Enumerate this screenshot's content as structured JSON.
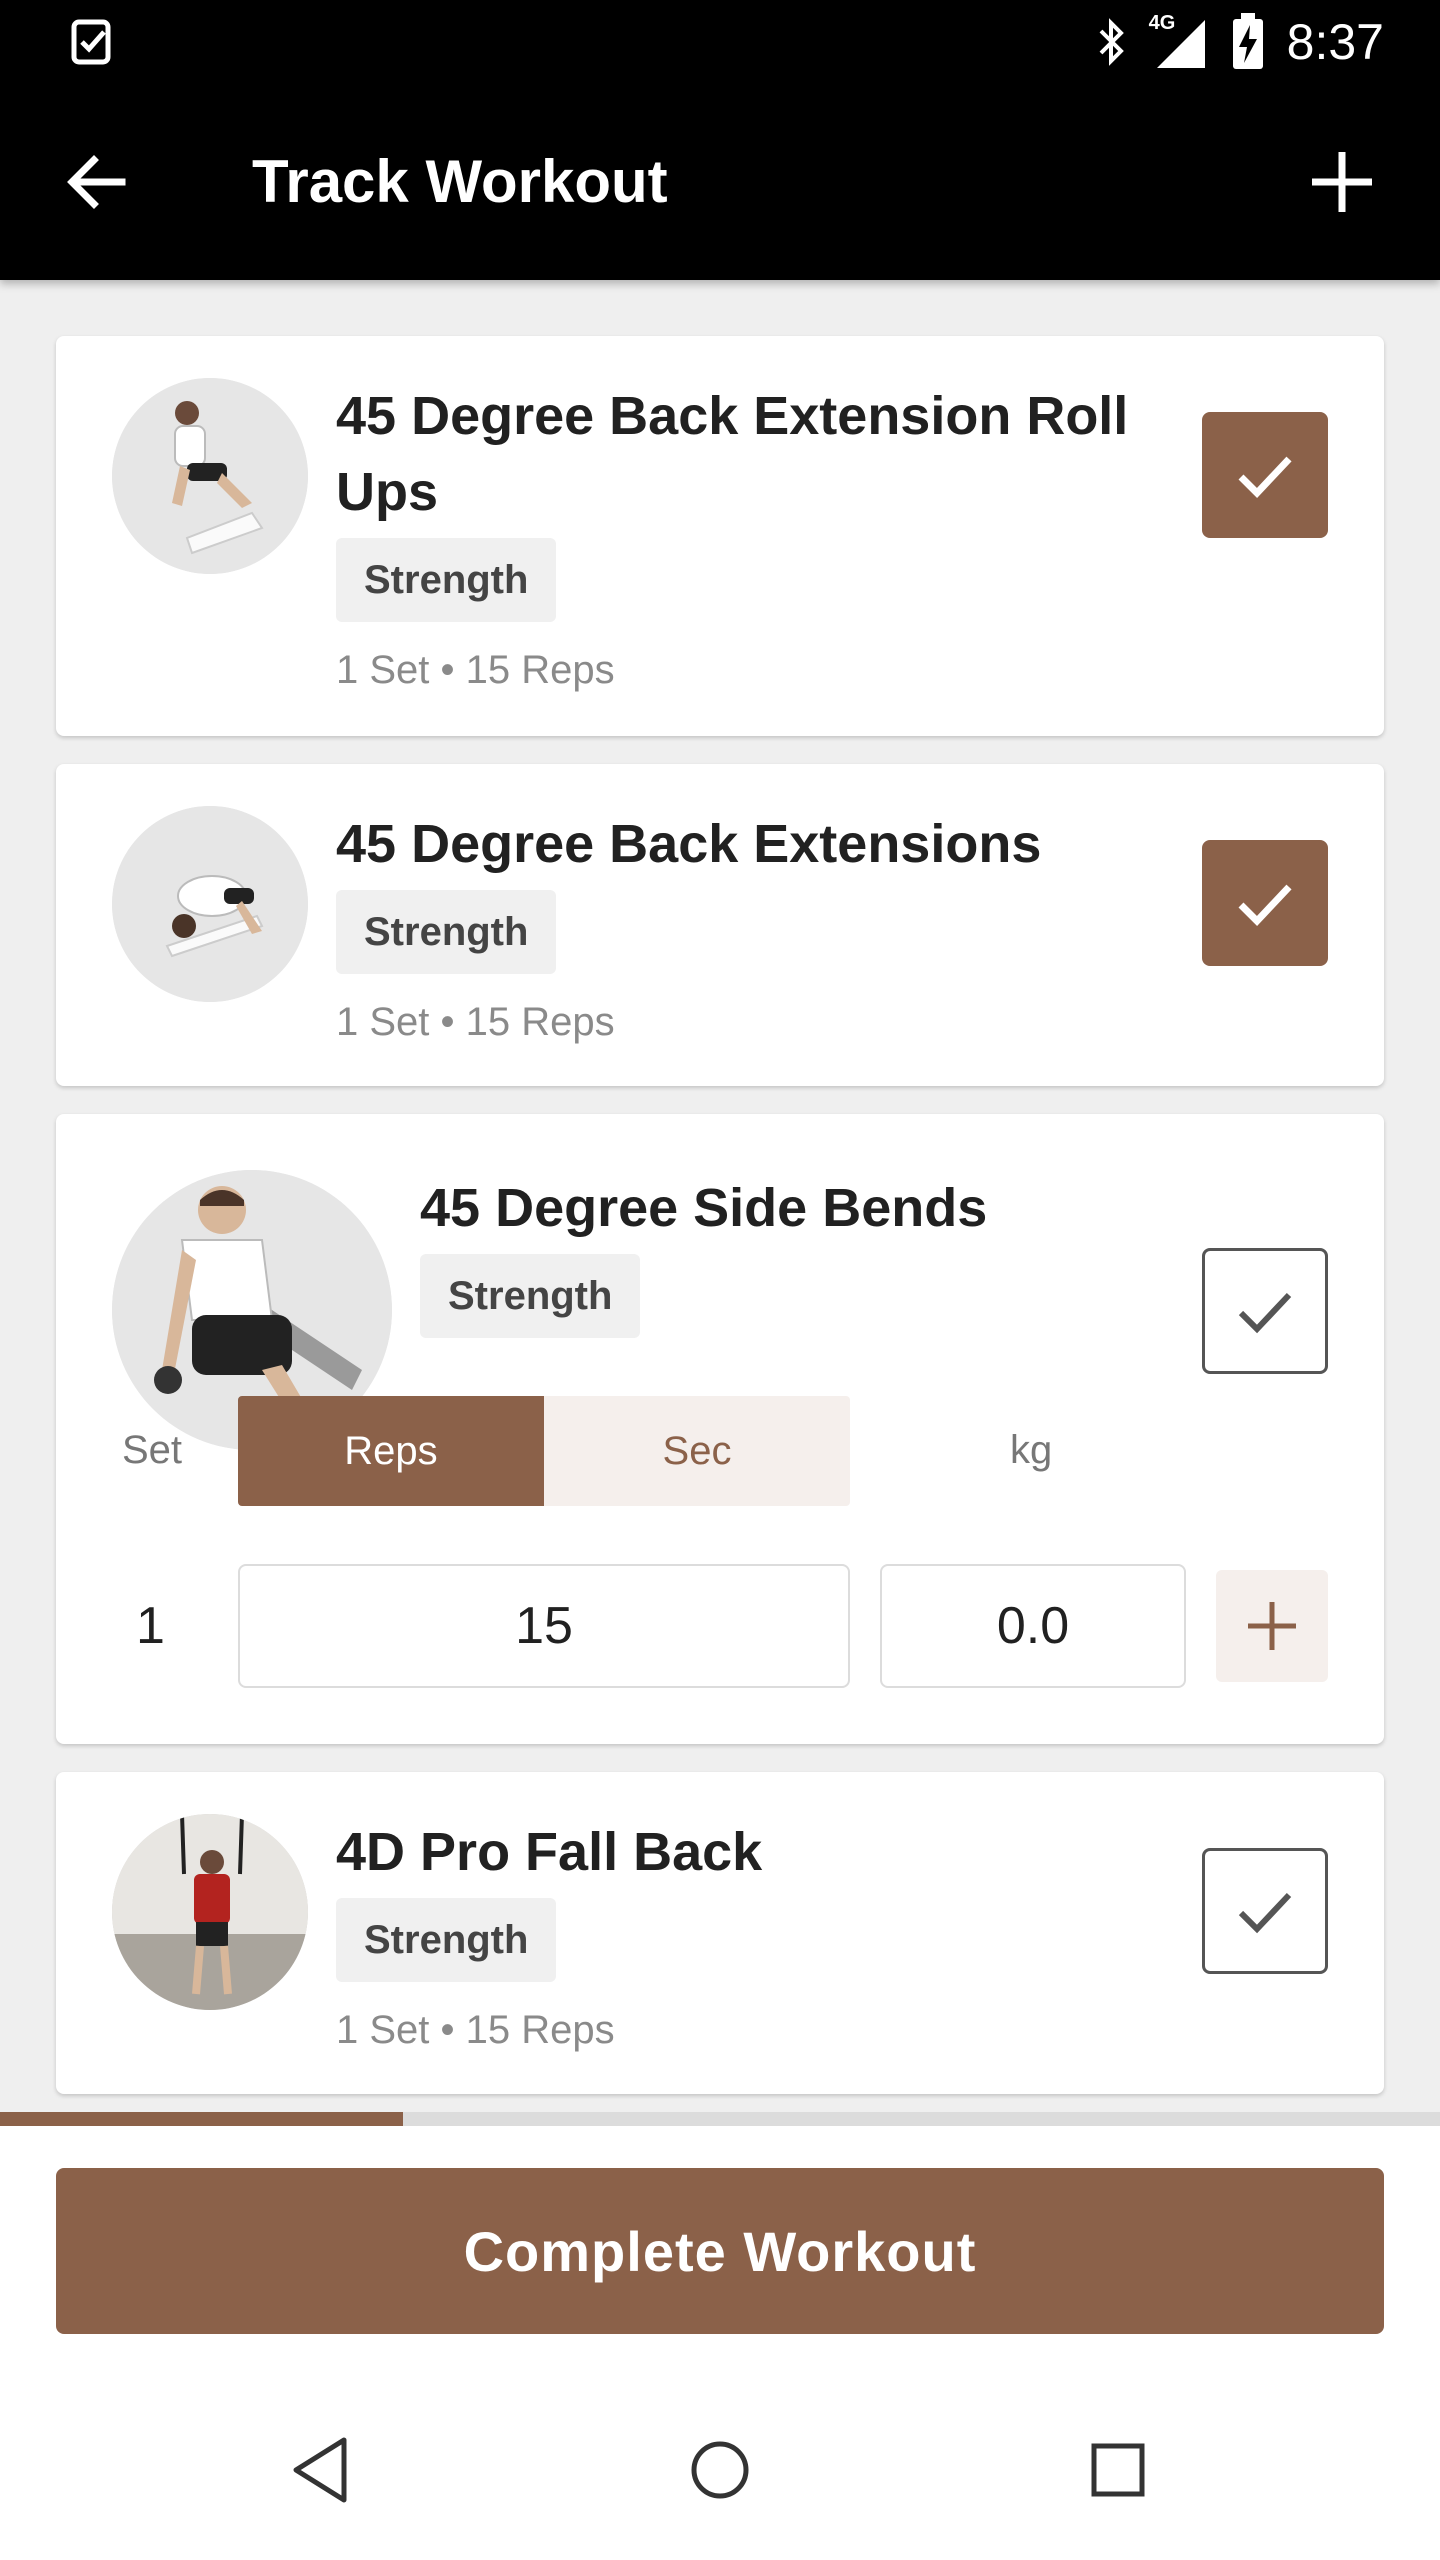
{
  "status_bar": {
    "time": "8:37",
    "network": "4G",
    "icons": [
      "task-check-icon",
      "bluetooth-icon",
      "signal-icon",
      "battery-charging-icon"
    ]
  },
  "app_bar": {
    "title": "Track Workout",
    "icons": [
      "back-arrow-icon",
      "plus-icon"
    ]
  },
  "exercises": [
    {
      "name": "45 Degree Back Extension Roll Ups",
      "category": "Strength",
      "summary": "1 Set • 15 Reps",
      "completed": true
    },
    {
      "name": "45 Degree Back Extensions",
      "category": "Strength",
      "summary": "1 Set • 15 Reps",
      "completed": true
    },
    {
      "name": "45 Degree Side Bends",
      "category": "Strength",
      "completed": false,
      "expanded": true,
      "columns": {
        "set": "Set",
        "reps": "Reps",
        "sec": "Sec",
        "weight": "kg"
      },
      "active_mode": "Reps",
      "sets": [
        {
          "number": "1",
          "reps": "15",
          "weight": "0.0"
        }
      ]
    },
    {
      "name": "4D Pro Fall Back",
      "category": "Strength",
      "summary": "1 Set • 15 Reps",
      "completed": false
    }
  ],
  "progress": {
    "fraction": 0.28
  },
  "complete_button": {
    "label": "Complete Workout"
  },
  "colors": {
    "accent": "#8b6149",
    "background": "#efefef",
    "appbar": "#000000"
  },
  "nav_bar": {
    "icons": [
      "back-triangle-icon",
      "home-circle-icon",
      "recents-square-icon"
    ]
  }
}
